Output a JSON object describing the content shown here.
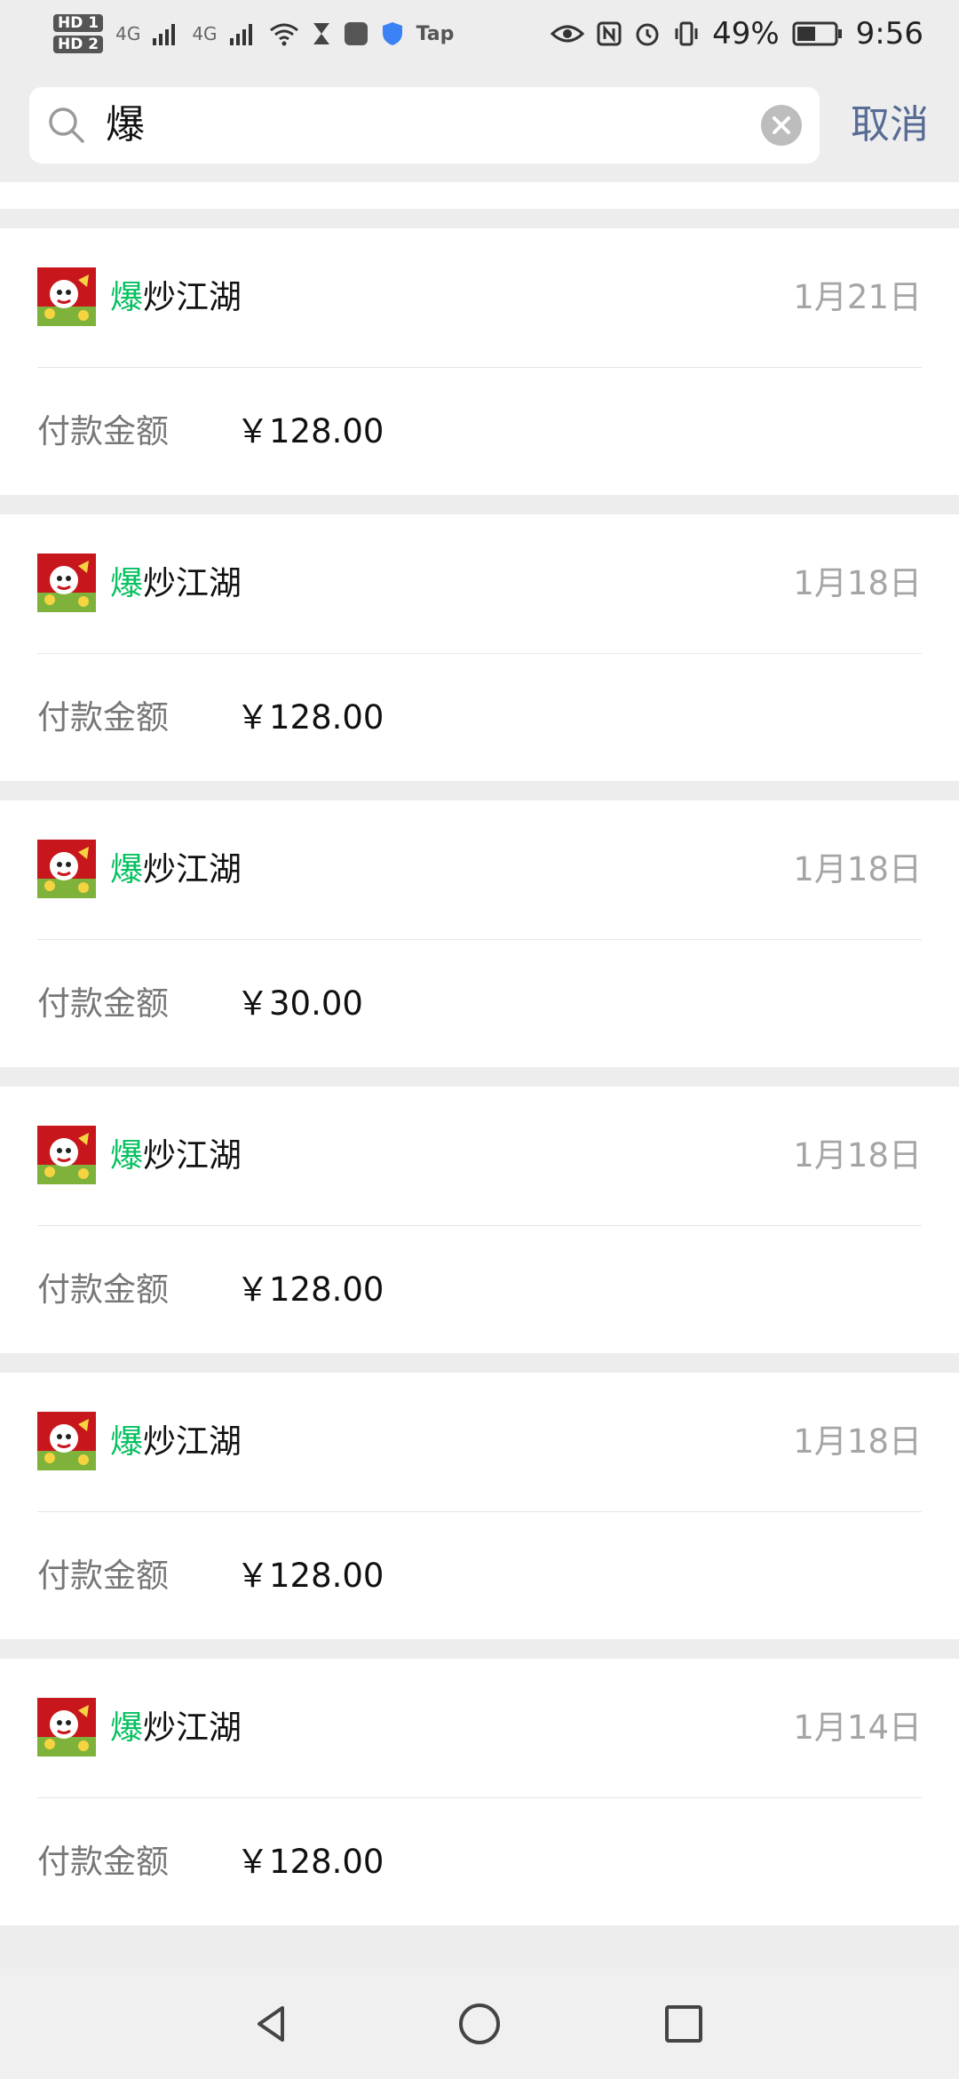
{
  "status_bar": {
    "hd1": "HD 1",
    "hd2": "HD 2",
    "net1": "4G",
    "net2": "4G",
    "tap": "Tap",
    "battery": "49%",
    "time": "9:56"
  },
  "search": {
    "query": "爆",
    "cancel_label": "取消"
  },
  "results": [
    {
      "app_highlight": "爆",
      "app_rest": "炒江湖",
      "date": "1月21日",
      "amount_label": "付款金额",
      "amount": "￥128.00"
    },
    {
      "app_highlight": "爆",
      "app_rest": "炒江湖",
      "date": "1月18日",
      "amount_label": "付款金额",
      "amount": "￥128.00"
    },
    {
      "app_highlight": "爆",
      "app_rest": "炒江湖",
      "date": "1月18日",
      "amount_label": "付款金额",
      "amount": "￥30.00"
    },
    {
      "app_highlight": "爆",
      "app_rest": "炒江湖",
      "date": "1月18日",
      "amount_label": "付款金额",
      "amount": "￥128.00"
    },
    {
      "app_highlight": "爆",
      "app_rest": "炒江湖",
      "date": "1月18日",
      "amount_label": "付款金额",
      "amount": "￥128.00"
    },
    {
      "app_highlight": "爆",
      "app_rest": "炒江湖",
      "date": "1月14日",
      "amount_label": "付款金额",
      "amount": "￥128.00"
    }
  ],
  "colors": {
    "highlight": "#07c160",
    "cancel": "#576b95",
    "background": "#ededed"
  },
  "icons": [
    "search-icon",
    "clear-icon",
    "back-icon",
    "home-icon",
    "recents-icon",
    "app-icon"
  ]
}
